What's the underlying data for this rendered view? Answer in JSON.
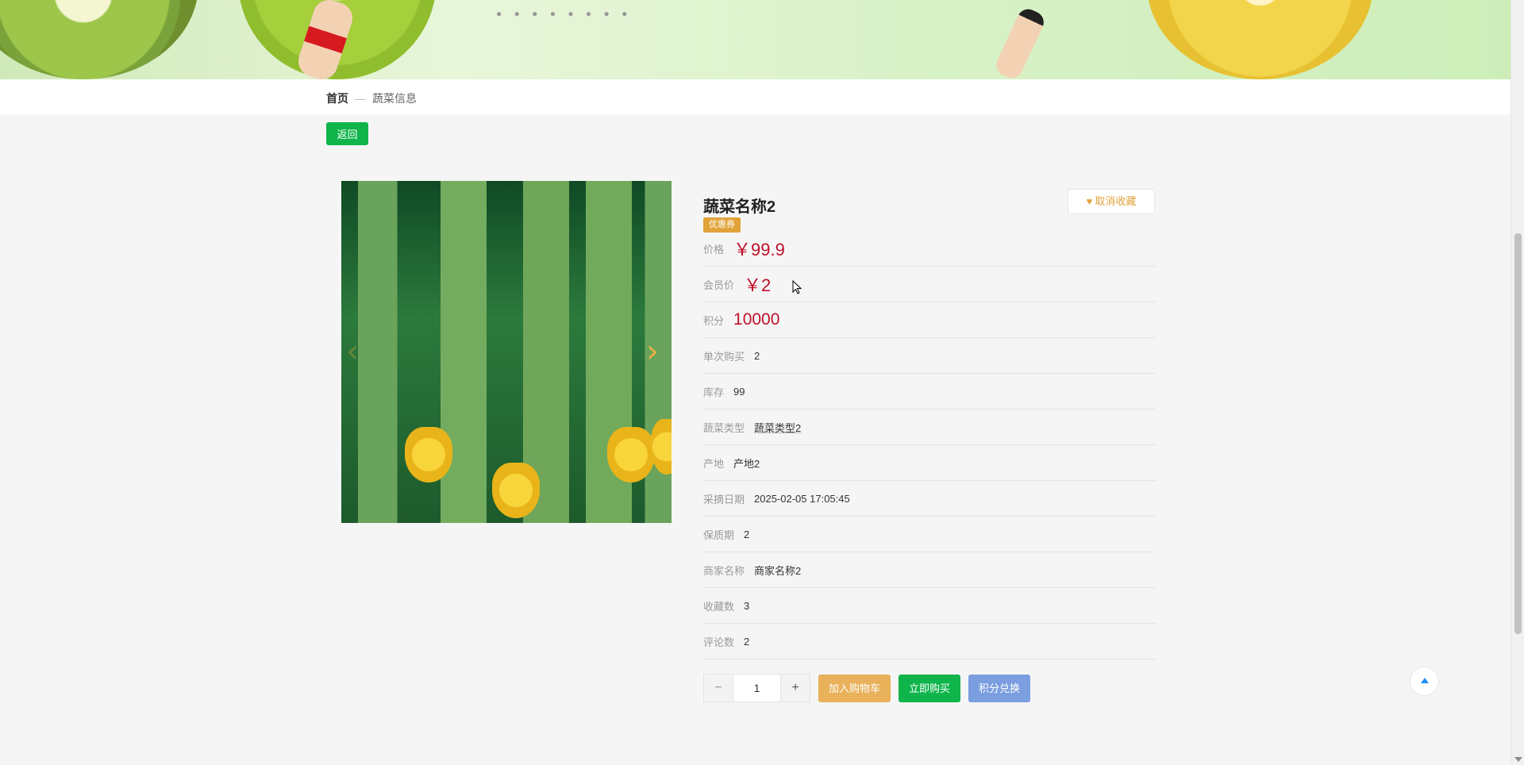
{
  "breadcrumb": {
    "home": "首页",
    "separator": "—",
    "current": "蔬菜信息"
  },
  "back_button": "返回",
  "product": {
    "title": "蔬菜名称2",
    "coupon_badge": "优惠券",
    "favorite_button": "取消收藏",
    "fields": [
      {
        "label": "价格",
        "value": "￥99.9",
        "style": "price"
      },
      {
        "label": "会员价",
        "value": "￥2",
        "style": "price"
      },
      {
        "label": "积分",
        "value": "10000",
        "style": "points"
      },
      {
        "label": "单次购买",
        "value": "2",
        "style": "plain"
      },
      {
        "label": "库存",
        "value": "99",
        "style": "plain"
      },
      {
        "label": "蔬菜类型",
        "value": "蔬菜类型2",
        "style": "link"
      },
      {
        "label": "产地",
        "value": "产地2",
        "style": "plain"
      },
      {
        "label": "采摘日期",
        "value": "2025-02-05 17:05:45",
        "style": "plain"
      },
      {
        "label": "保质期",
        "value": "2",
        "style": "plain"
      },
      {
        "label": "商家名称",
        "value": "商家名称2",
        "style": "plain"
      },
      {
        "label": "收藏数",
        "value": "3",
        "style": "plain"
      },
      {
        "label": "评论数",
        "value": "2",
        "style": "plain"
      }
    ]
  },
  "quantity": {
    "minus": "−",
    "value": "1",
    "plus": "+"
  },
  "actions": {
    "add_to_cart": "加入购物车",
    "buy_now": "立即购买",
    "redeem_points": "积分兑换"
  },
  "colors": {
    "accent_green": "#0fb54b",
    "price_red": "#c0102a",
    "coupon_orange": "#e2a23a",
    "cart_orange": "#e8b15a",
    "redeem_blue": "#7a9ee0"
  },
  "icons": {
    "favorite": "heart-icon",
    "carousel_prev": "chevron-left-icon",
    "carousel_next": "chevron-right-icon",
    "back_to_top": "arrow-up-icon"
  }
}
